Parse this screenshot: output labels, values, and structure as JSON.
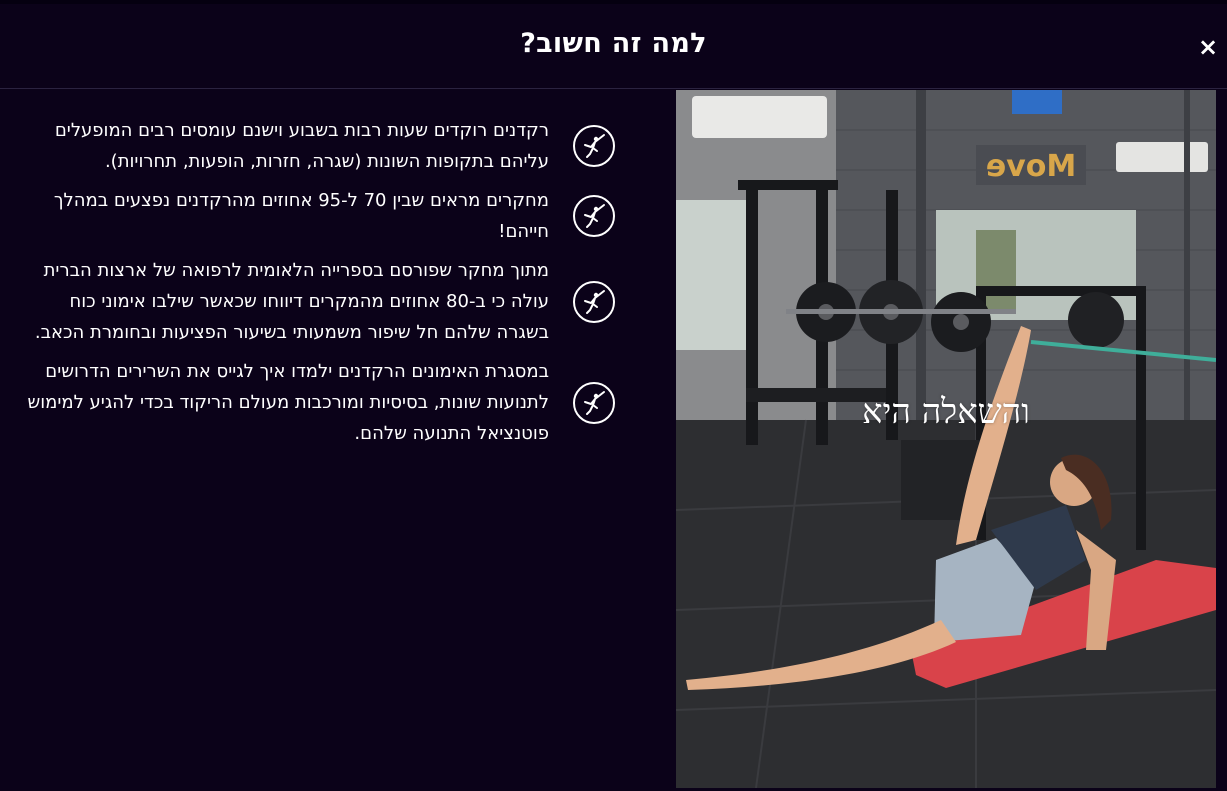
{
  "modal": {
    "title": "למה זה חשוב?",
    "close_label": "×"
  },
  "benefits": [
    {
      "icon": "dancer-icon",
      "text": "רקדנים רוקדים שעות רבות בשבוע וישנם עומסים רבים המופעלים עליהם בתקופות השונות (שגרה, חזרות, הופעות, תחרויות)."
    },
    {
      "icon": "dancer-icon",
      "text": "מחקרים מראים שבין 70 ל-95 אחוזים מהרקדנים נפצעים במהלך חייהם!"
    },
    {
      "icon": "dancer-icon",
      "text": "מתוך מחקר שפורסם בספרייה הלאומית לרפואה של ארצות הברית עולה כי ב-80 אחוזים מהמקרים דיווחו שכאשר שילבו אימוני כוח בשגרה שלהם חל שיפור משמעותי בשיעור הפציעות ובחומרת הכאב."
    },
    {
      "icon": "dancer-icon",
      "text": "במסגרת האימונים הרקדנים ילמדו איך לגייס את השרירים הדרושים לתנועות שונות, בסיסיות ומורכבות מעולם הריקוד בכדי להגיע למימוש פוטנציאל התנועה שלהם."
    }
  ],
  "video": {
    "caption": "והשאלה היא",
    "sign_text": "Move"
  },
  "colors": {
    "background": "#0b0219",
    "text": "#ffffff",
    "mat": "#d9434a",
    "band": "#3fae9a"
  }
}
